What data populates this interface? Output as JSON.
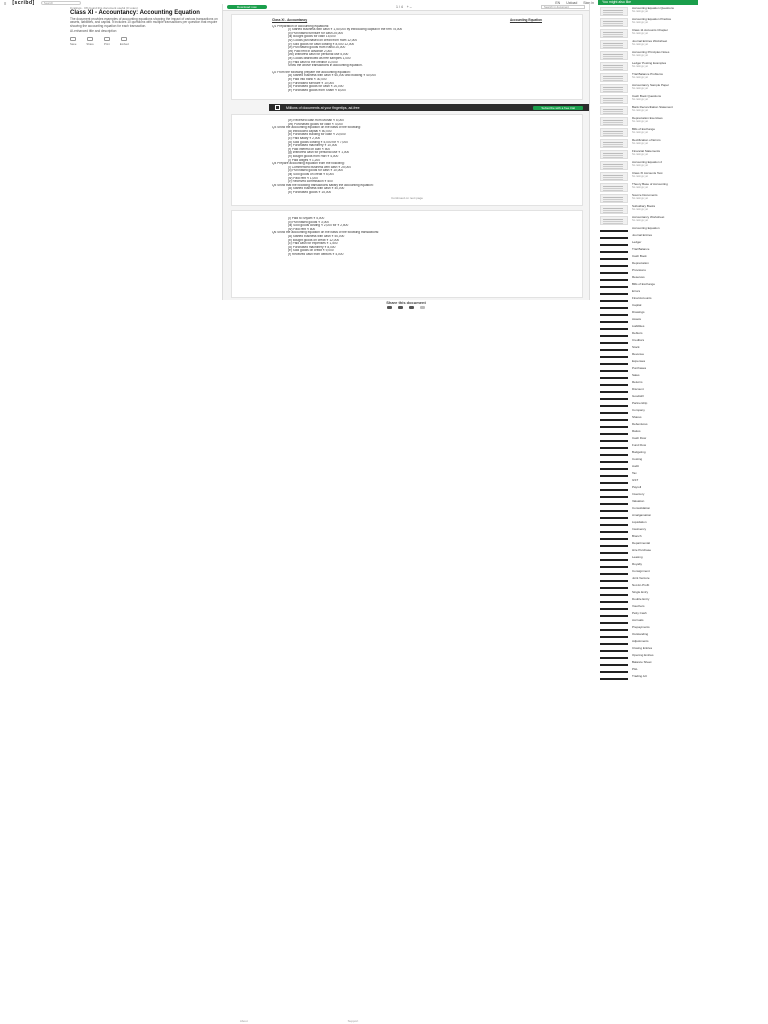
{
  "topbar": {
    "menu_label": "≡",
    "logo": "[scribd]",
    "search_placeholder": "Search",
    "upload": "Upload",
    "language": "EN",
    "signin": "Sign in"
  },
  "left": {
    "crumb": "0 ratings · 0% found this document useful (0 votes)",
    "title": "Class XI - Accountancy: Accounting Equation",
    "description": "The document provides examples of accounting equations showing the impact of various transactions on assets, liabilities, and capital. It includes 10 questions with multiple transactions per question that require showing the accounting equation for each transaction.",
    "tags": "AI-enhanced title and description",
    "stats": [
      {
        "label": "Save",
        "icon": "bookmark-icon"
      },
      {
        "label": "Share",
        "icon": "share-icon"
      },
      {
        "label": "Print",
        "icon": "print-icon"
      },
      {
        "label": "Embed",
        "icon": "embed-icon"
      }
    ]
  },
  "viewer": {
    "download_label": "Download now",
    "page_info": "1 / 4",
    "zoom": "+ –",
    "find_placeholder": "Search in document",
    "page1": {
      "heading_left": "Class XI - Accountancy",
      "heading_right": "Accounting Equation",
      "lines": [
        "Q1 Preparation of accounting equations:",
        "(i) Started business with cash ₹ 1,50,000 by introducing capital in the firm 75,000",
        "(ii) Purchased furniture for cash 25,000",
        "(iii) Bought goods for cash 15,000",
        "(iv) Goods purchased on credit from Ram 12,000",
        "(v) Sold goods for cash costing ₹ 8,000 12,000",
        "(vi) Purchased goods from Rahul 20,000",
        "(vii) Paid rent in advance 2,000",
        "(viii) Withdrew cash for personal use 5,000",
        "(ix) Goods distributed as free samples 1,000",
        "(x) Paid cash to the creditor 10,000",
        "Show the above transactions in accounting equation."
      ],
      "q2": [
        "Q2 From the following prepare the accounting equation:",
        "(a) Started business with cash ₹ 60,000 and building ₹ 40,000",
        "(b) Paid into bank ₹ 30,000",
        "(c) Purchased furniture ₹ 10,000",
        "(d) Purchased goods for cash ₹ 20,000",
        "(e) Purchased goods from Sham ₹ 8,000"
      ]
    },
    "banner": {
      "text": "Millions of documents at your fingertips, ad-free",
      "cta": "Subscribe with a free trial"
    },
    "page2": {
      "lines": [
        "(vi) Received cash from Mohan ₹ 5,000",
        "(vii) Purchased goods for cash ₹ 4,000",
        "Q3 Show the accounting equation on the basis of the following:",
        "(a) Introduced capital ₹ 50,000",
        "(b) Purchased building for cash ₹ 20,000",
        "(c) Paid salary ₹ 2,000",
        "(d) Sold goods costing ₹ 5,000 for ₹ 7,000",
        "(e) Purchased machinery ₹ 10,000",
        "(f) Paid interest on loan ₹ 500",
        "(g) Withdrew cash for personal use ₹ 1,000",
        "(h) Bought goods from Hari ₹ 4,000",
        "(i) Paid wages ₹ 1,200",
        "Q4 Prepare accounting equation from the following:",
        "(i) Commenced business with cash ₹ 25,000",
        "(ii) Purchased goods for cash ₹ 10,000",
        "(iii) Sold goods on credit ₹ 6,000",
        "(iv) Paid rent ₹ 1,000",
        "(v) Received commission ₹ 500",
        "Q5 Show that the following transactions satisfy the accounting equation:",
        "(a) Started business with cash ₹ 40,000",
        "(b) Purchased goods ₹ 15,000"
      ],
      "continue_label": "Continued on next page"
    },
    "page3": {
      "lines": [
        "(i) Paid to Shyam ₹ 5,000",
        "(ii) Purchased goods ₹ 3,000",
        "(iii) Sold goods costing ₹ 2,000 for ₹ 2,500",
        "(iv) Paid rent ₹ 800",
        "Q6 Show the accounting equation on the basis of the following transactions:",
        "(a) Started business with cash ₹ 50,000",
        "(b) Bought goods on credit ₹ 12,000",
        "(c) Paid cash for expenses ₹ 1,500",
        "(d) Purchased machinery ₹ 8,000",
        "(e) Sold goods on credit ₹ 9,000",
        "(f) Received cash from debtors ₹ 4,000"
      ]
    }
  },
  "share": {
    "title": "Share this document"
  },
  "sidebar": {
    "header": "You might also like",
    "items": [
      {
        "title": "Accounting Equation Questions",
        "meta": "No ratings yet"
      },
      {
        "title": "Accounting Equation Practice",
        "meta": "No ratings yet"
      },
      {
        "title": "Class 11 Accounts Chapter",
        "meta": "No ratings yet"
      },
      {
        "title": "Journal Entries Worksheet",
        "meta": "No ratings yet"
      },
      {
        "title": "Accounting Principles Notes",
        "meta": "No ratings yet"
      },
      {
        "title": "Ledger Posting Examples",
        "meta": "No ratings yet"
      },
      {
        "title": "Trial Balance Problems",
        "meta": "No ratings yet"
      },
      {
        "title": "Accountancy Sample Paper",
        "meta": "No ratings yet"
      },
      {
        "title": "Cash Book Questions",
        "meta": "No ratings yet"
      },
      {
        "title": "Bank Reconciliation Statement",
        "meta": "No ratings yet"
      },
      {
        "title": "Depreciation Exercises",
        "meta": "No ratings yet"
      },
      {
        "title": "Bills of Exchange",
        "meta": "No ratings yet"
      },
      {
        "title": "Rectification of Errors",
        "meta": "No ratings yet"
      },
      {
        "title": "Financial Statements",
        "meta": "No ratings yet"
      },
      {
        "title": "Accounting Equation 2",
        "meta": "No ratings yet"
      },
      {
        "title": "Class XI Accounts Test",
        "meta": "No ratings yet"
      },
      {
        "title": "Theory Base of Accounting",
        "meta": "No ratings yet"
      },
      {
        "title": "Source Documents",
        "meta": "No ratings yet"
      },
      {
        "title": "Subsidiary Books",
        "meta": "No ratings yet"
      },
      {
        "title": "Accountancy Worksheet",
        "meta": "No ratings yet"
      }
    ],
    "links": [
      "Accounting Equation",
      "Journal Entries",
      "Ledger",
      "Trial Balance",
      "Cash Book",
      "Depreciation",
      "Provisions",
      "Reserves",
      "Bills of Exchange",
      "Errors",
      "Final Accounts",
      "Capital",
      "Drawings",
      "Assets",
      "Liabilities",
      "Debtors",
      "Creditors",
      "Stock",
      "Revenue",
      "Expenses",
      "Purchases",
      "Sales",
      "Returns",
      "Discount",
      "Goodwill",
      "Partnership",
      "Company",
      "Shares",
      "Debentures",
      "Ratios",
      "Cash Flow",
      "Fund Flow",
      "Budgeting",
      "Costing",
      "Audit",
      "Tax",
      "GST",
      "Payroll",
      "Inventory",
      "Valuation",
      "Consolidation",
      "Amalgamation",
      "Liquidation",
      "Insolvency",
      "Branch",
      "Departmental",
      "Hire Purchase",
      "Leasing",
      "Royalty",
      "Consignment",
      "Joint Venture",
      "Not-for-Profit",
      "Single Entry",
      "Double Entry",
      "Vouchers",
      "Petty Cash",
      "Accruals",
      "Prepayments",
      "Outstanding",
      "Adjustments",
      "Closing Entries",
      "Opening Entries",
      "Balance Sheet",
      "P&L",
      "Trading A/c"
    ]
  },
  "footer": {
    "left": "About",
    "right": "Support"
  }
}
